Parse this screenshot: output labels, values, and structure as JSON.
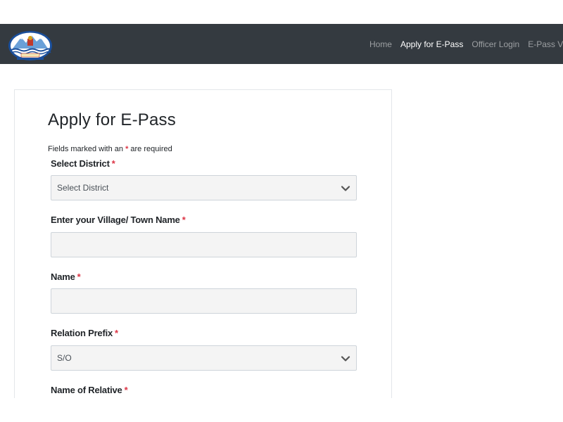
{
  "navbar": {
    "logo_icon": "jk-emblem-logo",
    "links": [
      {
        "label": "Home",
        "active": false
      },
      {
        "label": "Apply for E-Pass",
        "active": true
      },
      {
        "label": "Officer Login",
        "active": false
      },
      {
        "label": "E-Pass Validit",
        "active": false
      }
    ]
  },
  "form": {
    "title": "Apply for E-Pass",
    "required_note_prefix": "Fields marked with an",
    "required_note_star": "*",
    "required_note_suffix": "are required",
    "fields": {
      "district": {
        "label": "Select District",
        "star": "*",
        "selected": "Select District"
      },
      "village": {
        "label": "Enter your Village/ Town Name",
        "star": "*",
        "value": ""
      },
      "name": {
        "label": "Name",
        "star": "*",
        "value": ""
      },
      "relation_prefix": {
        "label": "Relation Prefix",
        "star": "*",
        "selected": "S/O"
      },
      "relative_name": {
        "label": "Name of Relative",
        "star": "*"
      }
    }
  },
  "colors": {
    "navbar_bg": "#343a40",
    "required_star": "#dc3545",
    "input_bg": "#f4f4f4"
  }
}
